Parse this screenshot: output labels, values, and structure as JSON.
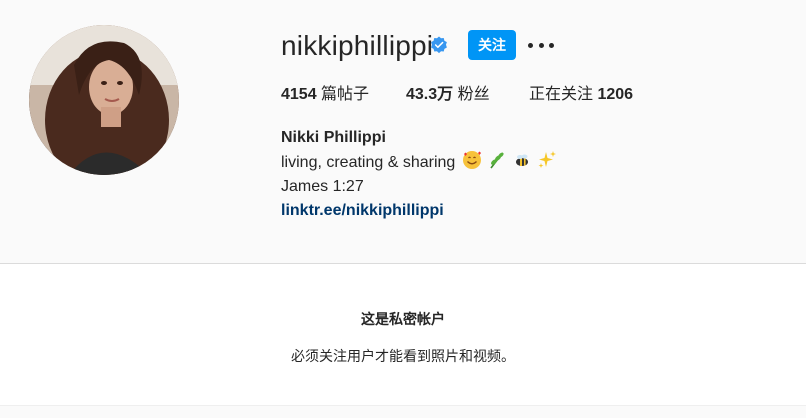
{
  "profile": {
    "username": "nikkiphillippi",
    "verified_icon": "verified-badge-icon",
    "follow_label": "关注",
    "more_icon": "more-options-icon",
    "stats": {
      "posts_count": "4154",
      "posts_label": "篇帖子",
      "followers_count": "43.3万",
      "followers_label": "粉丝",
      "following_label": "正在关注",
      "following_count": "1206"
    },
    "bio": {
      "full_name": "Nikki Phillippi",
      "line1": "living, creating & sharing",
      "line2": "James 1:27",
      "link": "linktr.ee/nikkiphillippi"
    }
  },
  "private_notice": {
    "title": "这是私密帐户",
    "subtitle": "必须关注用户才能看到照片和视频。"
  },
  "colors": {
    "accent": "#0095f6",
    "link": "#00376b",
    "background": "#fafafa"
  }
}
